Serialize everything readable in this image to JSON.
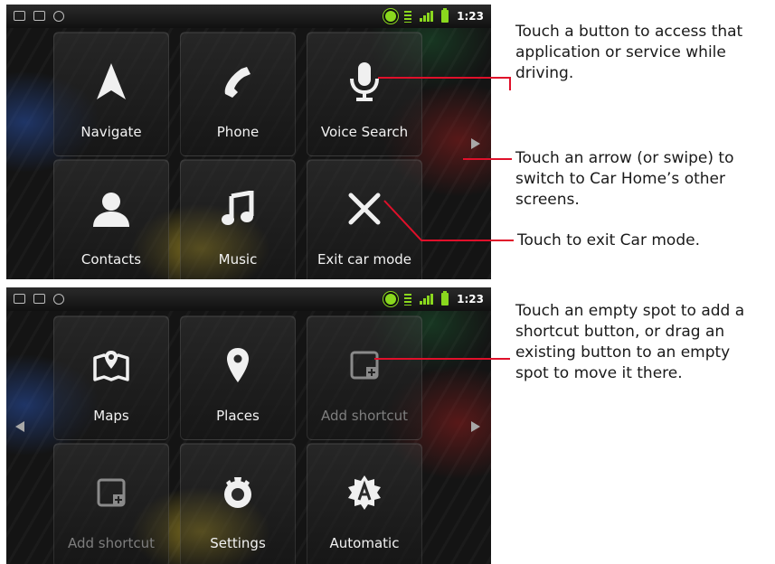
{
  "status_bar": {
    "time": "1:23"
  },
  "screen1": {
    "tiles": [
      {
        "label": "Navigate",
        "icon": "navigate-icon"
      },
      {
        "label": "Phone",
        "icon": "phone-icon"
      },
      {
        "label": "Voice Search",
        "icon": "microphone-icon"
      },
      {
        "label": "Contacts",
        "icon": "contacts-icon"
      },
      {
        "label": "Music",
        "icon": "music-note-icon"
      },
      {
        "label": "Exit car mode",
        "icon": "close-x-icon"
      }
    ]
  },
  "screen2": {
    "tiles": [
      {
        "label": "Maps",
        "icon": "map-icon"
      },
      {
        "label": "Places",
        "icon": "map-pin-icon"
      },
      {
        "label": "Add shortcut",
        "icon": "add-shortcut-icon"
      },
      {
        "label": "Add shortcut",
        "icon": "add-shortcut-icon"
      },
      {
        "label": "Settings",
        "icon": "gear-icon"
      },
      {
        "label": "Automatic",
        "icon": "automatic-icon"
      }
    ]
  },
  "callouts": {
    "buttons": [
      "Touch a button to access that",
      "application or service while",
      "driving."
    ],
    "arrow": [
      "Touch an arrow (or swipe) to",
      "switch to Car Home’s other",
      "screens."
    ],
    "exit": [
      "Touch to exit Car mode."
    ],
    "shortcut": [
      "Touch an empty spot to add a",
      "shortcut button, or drag an",
      "existing button to an empty",
      "spot to move it there."
    ]
  },
  "colors": {
    "status_green": "#8ad81e",
    "tile_label": "#f2f2f2",
    "dim_label": "#7e7e7e",
    "leader_line": "#e0102a"
  }
}
